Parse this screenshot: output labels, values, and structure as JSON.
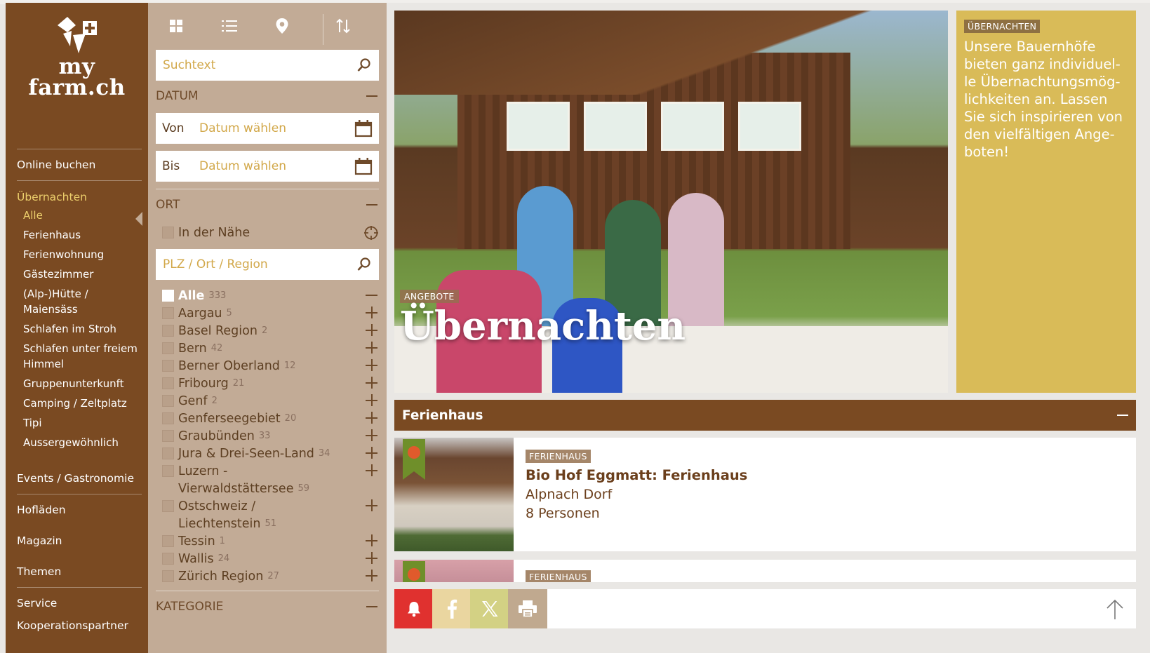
{
  "logo": {
    "line1": "my",
    "line2": "farm.ch"
  },
  "nav": {
    "online": "Online buchen",
    "uebernachten": "Übernachten",
    "sub": [
      "Alle",
      "Ferienhaus",
      "Ferienwohnung",
      "Gästezimmer",
      "(Alp-)Hütte / Maiensäss",
      "Schlafen im Stroh",
      "Schlafen unter freiem Himmel",
      "Gruppenunterkunft",
      "Camping / Zeltplatz",
      "Tipi",
      "Aussergewöhnlich"
    ],
    "events": "Events / Gastronomie",
    "hoflaeden": "Hofläden",
    "magazin": "Magazin",
    "themen": "Themen",
    "service": "Service",
    "cut": "Kooperationspartner"
  },
  "filters": {
    "search_placeholder": "Suchtext",
    "datum": "DATUM",
    "von": "Von",
    "bis": "Bis",
    "datum_placeholder": "Datum wählen",
    "ort": "ORT",
    "nearby": "In der Nähe",
    "plz_placeholder": "PLZ / Ort / Region",
    "regions": [
      {
        "name": "Alle",
        "count": "333"
      },
      {
        "name": "Aargau",
        "count": "5"
      },
      {
        "name": "Basel Region",
        "count": "2"
      },
      {
        "name": "Bern",
        "count": "42"
      },
      {
        "name": "Berner Oberland",
        "count": "12"
      },
      {
        "name": "Fribourg",
        "count": "21"
      },
      {
        "name": "Genf",
        "count": "2"
      },
      {
        "name": "Genferseegebiet",
        "count": "20"
      },
      {
        "name": "Graubünden",
        "count": "33"
      },
      {
        "name": "Jura & Drei-Seen-Land",
        "count": "34"
      },
      {
        "name": "Luzern -",
        "cont": "Vierwaldstättersee",
        "count": "59"
      },
      {
        "name": "Ostschweiz /",
        "cont": "Liechtenstein",
        "count": "51"
      },
      {
        "name": "Tessin",
        "count": "1"
      },
      {
        "name": "Wallis",
        "count": "24"
      },
      {
        "name": "Zürich Region",
        "count": "27"
      }
    ],
    "kategorie": "KATEGORIE"
  },
  "hero": {
    "tag": "ANGEBOTE",
    "title": "Übernachten"
  },
  "promo": {
    "tag": "ÜBERNACHTEN",
    "text": "Unsere Bauernhöfe bieten ganz individuel-le Übernachtungsmög-lichkeiten an. Lassen Sie sich inspirieren von den vielfältigen Ange-boten!"
  },
  "category": "Ferienhaus",
  "cards": [
    {
      "tag": "FERIENHAUS",
      "title": "Bio Hof Eggmatt: Ferienhaus",
      "place": "Alpnach Dorf",
      "persons": "8 Personen"
    },
    {
      "tag": "FERIENHAUS"
    }
  ],
  "colors": {
    "brown": "#7a4a22",
    "panel": "#c2ab96",
    "gold": "#d9bb58",
    "accent": "#eccf6c"
  }
}
